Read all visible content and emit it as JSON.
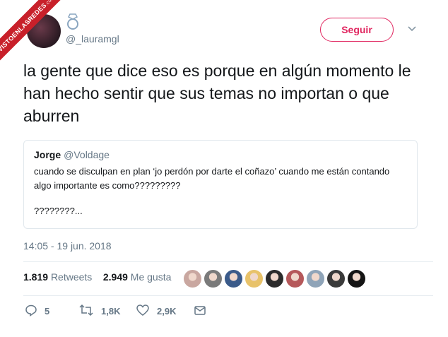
{
  "watermark": {
    "main": "VISTOENLASREDES",
    "sub": ".com"
  },
  "user": {
    "handle": "@_lauramgl",
    "ring_icon": "ring-icon",
    "avatar_icon": "avatar-photo"
  },
  "follow_button": {
    "label": "Seguir",
    "color": "#e0245e"
  },
  "menu_icon": "chevron-down-icon",
  "tweet": {
    "text": "la gente que dice eso es porque en algún momento le han hecho sentir que sus temas no importan o que aburren"
  },
  "quoted_tweet": {
    "name": "Jorge",
    "handle": "@Voldage",
    "text": "cuando se disculpan en plan ‘jo perdón por darte el coñazo’ cuando me están contando algo importante es como?????????",
    "text2": "????????..."
  },
  "timestamp": "14:05 - 19 jun. 2018",
  "stats": {
    "retweets_count": "1.819",
    "retweets_label": "Retweets",
    "likes_count": "2.949",
    "likes_label": "Me gusta"
  },
  "liker_avatars": [
    {
      "icon": "liker-avatar-1",
      "color": "#c9a7a0"
    },
    {
      "icon": "liker-avatar-2",
      "color": "#7a7a7a"
    },
    {
      "icon": "liker-avatar-3",
      "color": "#3b5b8a"
    },
    {
      "icon": "liker-avatar-4",
      "color": "#e8c26a"
    },
    {
      "icon": "liker-avatar-5",
      "color": "#2b2b2b"
    },
    {
      "icon": "liker-avatar-6",
      "color": "#b5585a"
    },
    {
      "icon": "liker-avatar-7",
      "color": "#8fa4b8"
    },
    {
      "icon": "liker-avatar-8",
      "color": "#3a3a3a"
    },
    {
      "icon": "liker-avatar-9",
      "color": "#151515"
    }
  ],
  "actions": {
    "replies": "5",
    "retweets": "1,8K",
    "likes": "2,9K",
    "reply_icon": "reply-icon",
    "retweet_icon": "retweet-icon",
    "like_icon": "heart-icon",
    "dm_icon": "envelope-icon"
  },
  "colors": {
    "text": "#14171a",
    "secondary": "#657786",
    "border": "#e1e8ed",
    "watermark": "#c8202a"
  }
}
